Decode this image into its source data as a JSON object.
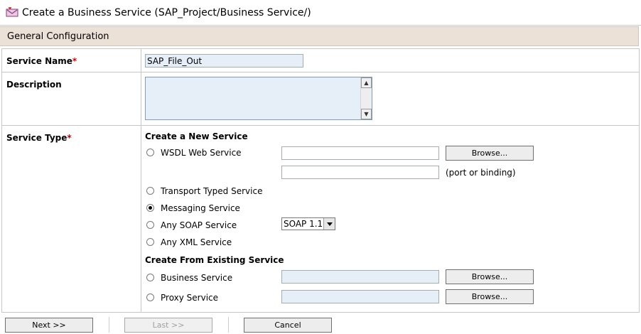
{
  "page": {
    "title": "Create a Business Service (SAP_Project/Business Service/)",
    "section_title": "General Configuration"
  },
  "form": {
    "service_name": {
      "label": "Service Name",
      "required_mark": "*",
      "value": "SAP_File_Out"
    },
    "description": {
      "label": "Description",
      "value": ""
    },
    "service_type": {
      "label": "Service Type",
      "required_mark": "*"
    }
  },
  "create_new": {
    "heading": "Create a New Service",
    "wsdl": {
      "label": "WSDL Web Service",
      "value": "",
      "port_value": "",
      "port_hint": "(port or binding)",
      "browse_label": "Browse..."
    },
    "transport": {
      "label": "Transport Typed Service"
    },
    "messaging": {
      "label": "Messaging Service",
      "checked": true
    },
    "any_soap": {
      "label": "Any SOAP Service",
      "selected": "SOAP 1.1"
    },
    "any_xml": {
      "label": "Any XML Service"
    }
  },
  "create_existing": {
    "heading": "Create From Existing Service",
    "business": {
      "label": "Business Service",
      "value": "",
      "browse_label": "Browse..."
    },
    "proxy": {
      "label": "Proxy Service",
      "value": "",
      "browse_label": "Browse..."
    }
  },
  "nav": {
    "next_label": "Next >>",
    "last_label": "Last >>",
    "cancel_label": "Cancel"
  },
  "icons": {
    "title_icon": "business-service-icon",
    "scroll_up": "arrow-up-icon",
    "scroll_down": "arrow-down-icon",
    "dropdown": "chevron-down-icon"
  },
  "colors": {
    "section_header_bg": "#ece1d6",
    "required": "#cc0000",
    "input_blue": "#e6eef7"
  }
}
